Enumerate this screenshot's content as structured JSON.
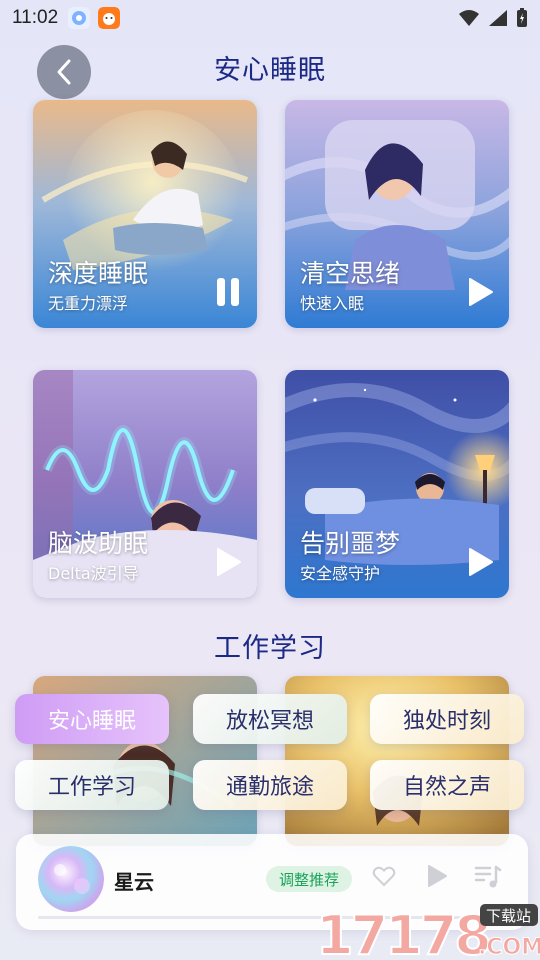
{
  "status_bar": {
    "time": "11:02"
  },
  "header": {
    "title": "安心睡眠"
  },
  "sleep_cards": [
    {
      "title": "深度睡眠",
      "subtitle": "无重力漂浮",
      "state": "playing"
    },
    {
      "title": "清空思绪",
      "subtitle": "快速入眠",
      "state": "paused"
    },
    {
      "title": "脑波助眠",
      "subtitle": "Delta波引导",
      "state": "paused"
    },
    {
      "title": "告别噩梦",
      "subtitle": "安全感守护",
      "state": "paused"
    }
  ],
  "work_section": {
    "title": "工作学习"
  },
  "categories": [
    {
      "label": "安心睡眠",
      "active": true
    },
    {
      "label": "放松冥想",
      "active": false
    },
    {
      "label": "独处时刻",
      "active": false
    },
    {
      "label": "工作学习",
      "active": false
    },
    {
      "label": "通勤旅途",
      "active": false
    },
    {
      "label": "自然之声",
      "active": false
    }
  ],
  "player": {
    "track_name": "星云",
    "adjust_label": "调整推荐"
  },
  "watermark": {
    "number": "17178",
    "domain": ".COM",
    "badge": "下载站"
  },
  "colors": {
    "accent_title": "#1c2a86",
    "active_chip": "#cf9cf5",
    "adjust_green": "#1aa35a"
  }
}
